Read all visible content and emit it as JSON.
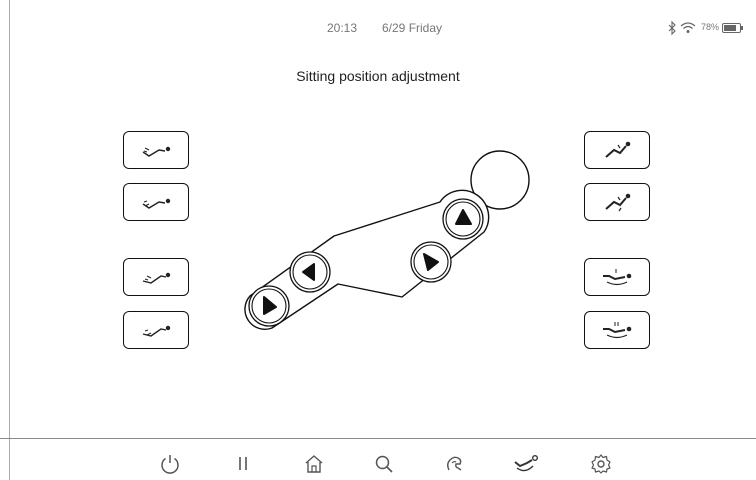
{
  "status_bar": {
    "time": "20:13",
    "date": "6/29 Friday",
    "battery": "78%",
    "icons": [
      "bluetooth-icon",
      "wifi-icon",
      "battery-icon"
    ]
  },
  "page": {
    "title": "Sitting position adjustment"
  },
  "left_buttons": [
    {
      "icon": "recline-forward-1-icon"
    },
    {
      "icon": "recline-backward-1-icon"
    },
    {
      "icon": "recline-forward-2-icon"
    },
    {
      "icon": "recline-backward-2-icon"
    }
  ],
  "right_buttons": [
    {
      "icon": "zero-gravity-1-icon"
    },
    {
      "icon": "zero-gravity-2-icon"
    },
    {
      "icon": "sitting-mode-1-icon"
    },
    {
      "icon": "sitting-mode-2-icon"
    }
  ],
  "bottom_nav": [
    "power-icon",
    "pause-icon",
    "home-icon",
    "search-icon",
    "massage-hand-icon",
    "chair-adjust-icon",
    "settings-icon"
  ],
  "colors": {
    "line": "#111111",
    "muted": "#777777",
    "background": "#ffffff"
  }
}
